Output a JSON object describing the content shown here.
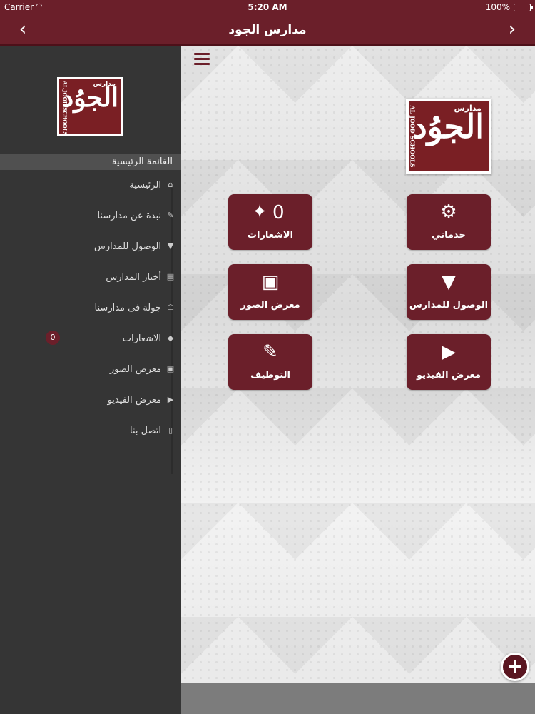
{
  "status_bar": {
    "carrier": "Carrier",
    "time": "5:20 AM",
    "battery": "100%",
    "battery_level": 1.0
  },
  "navbar": {
    "title": "مدارس الجود",
    "back_icon": "chevron-left-icon",
    "forward_icon": "chevron-right-icon"
  },
  "logo": {
    "top_text": "مدارس",
    "script": "الجوُد",
    "side_text": "AL JOOD SCHOOLS"
  },
  "sidebar": {
    "header": "القائمة الرئيسية",
    "items": [
      {
        "label": "الرئيسية",
        "icon": "home-icon"
      },
      {
        "label": "نبذة عن مدارسنا",
        "icon": "edit-icon"
      },
      {
        "label": "الوصول للمدارس",
        "icon": "map-marker-icon"
      },
      {
        "label": "أخبار المدارس",
        "icon": "newspaper-icon"
      },
      {
        "label": "جولة فى مدارسنا",
        "icon": "institution-icon"
      },
      {
        "label": "الاشعارات",
        "icon": "tags-icon",
        "badge": "0"
      },
      {
        "label": "معرض الصور",
        "icon": "image-icon"
      },
      {
        "label": "معرض الفيديو",
        "icon": "youtube-play-icon"
      },
      {
        "label": "اتصل بنا",
        "icon": "mobile-icon"
      }
    ]
  },
  "tiles": [
    {
      "label": "خدماتي",
      "icon": "gear-icon"
    },
    {
      "label": "الاشعارات",
      "icon": "magic-wand-icon",
      "count": "0"
    },
    {
      "label": "الوصول للمدارس",
      "icon": "map-marker-icon"
    },
    {
      "label": "معرض الصور",
      "icon": "image-icon"
    },
    {
      "label": "معرض الفيديو",
      "icon": "youtube-play-icon"
    },
    {
      "label": "التوظيف",
      "icon": "edit-icon"
    }
  ],
  "colors": {
    "brand": "#6b1f2a",
    "sidebar_bg": "#353535",
    "accent_dark": "#5a1621"
  }
}
